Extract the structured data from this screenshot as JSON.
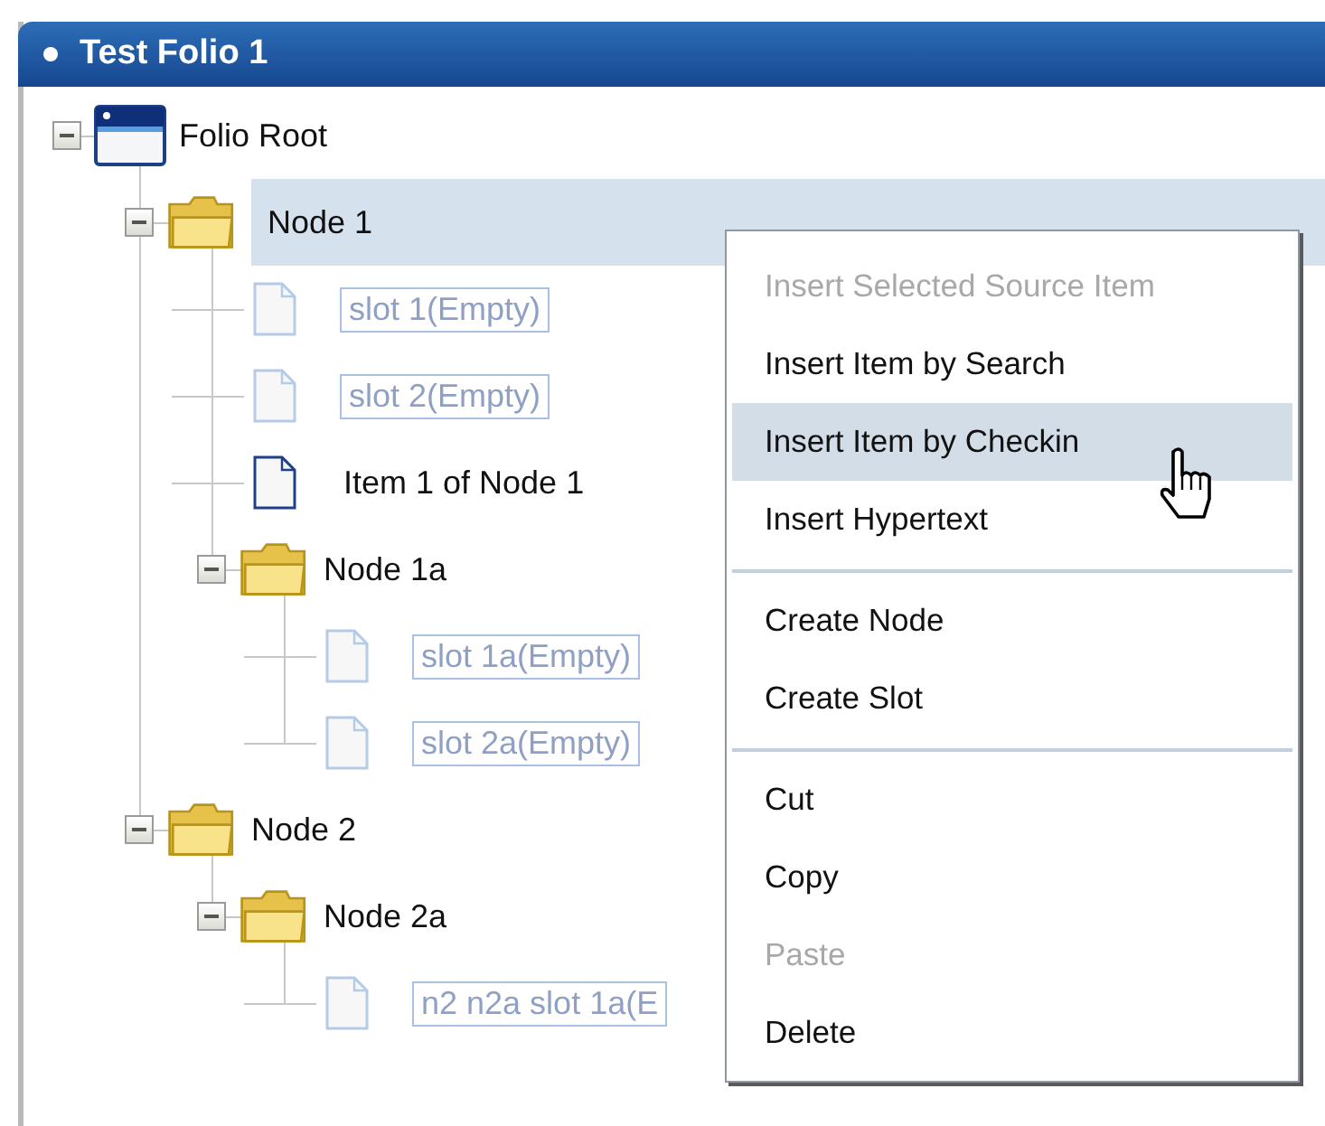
{
  "window": {
    "title": "Test Folio 1"
  },
  "tree": [
    {
      "kind": "root",
      "label": "Folio Root",
      "expanded": true,
      "selected": false,
      "children": [
        {
          "kind": "folder",
          "label": "Node 1",
          "expanded": true,
          "selected": true,
          "children": [
            {
              "kind": "slot",
              "label": "slot 1(Empty)",
              "selected": false
            },
            {
              "kind": "slot",
              "label": "slot 2(Empty)",
              "selected": false
            },
            {
              "kind": "item",
              "label": "Item 1 of Node 1",
              "selected": false
            },
            {
              "kind": "folder",
              "label": "Node 1a",
              "expanded": true,
              "selected": false,
              "children": [
                {
                  "kind": "slot",
                  "label": "slot 1a(Empty)",
                  "selected": false
                },
                {
                  "kind": "slot",
                  "label": "slot 2a(Empty)",
                  "selected": false
                }
              ]
            }
          ]
        },
        {
          "kind": "folder",
          "label": "Node 2",
          "expanded": true,
          "selected": false,
          "children": [
            {
              "kind": "folder",
              "label": "Node 2a",
              "expanded": true,
              "selected": false,
              "children": [
                {
                  "kind": "slot",
                  "label": "n2 n2a slot 1a(E",
                  "selected": false
                }
              ]
            }
          ]
        }
      ]
    }
  ],
  "context_menu": {
    "groups": [
      [
        {
          "label": "Insert Selected Source Item",
          "disabled": true,
          "highlighted": false
        },
        {
          "label": "Insert Item by Search",
          "disabled": false,
          "highlighted": false
        },
        {
          "label": "Insert Item by Checkin",
          "disabled": false,
          "highlighted": true
        },
        {
          "label": "Insert Hypertext",
          "disabled": false,
          "highlighted": false
        }
      ],
      [
        {
          "label": "Create Node",
          "disabled": false,
          "highlighted": false
        },
        {
          "label": "Create Slot",
          "disabled": false,
          "highlighted": false
        }
      ],
      [
        {
          "label": "Cut",
          "disabled": false,
          "highlighted": false
        },
        {
          "label": "Copy",
          "disabled": false,
          "highlighted": false
        },
        {
          "label": "Paste",
          "disabled": true,
          "highlighted": false
        },
        {
          "label": "Delete",
          "disabled": false,
          "highlighted": false
        }
      ]
    ]
  }
}
